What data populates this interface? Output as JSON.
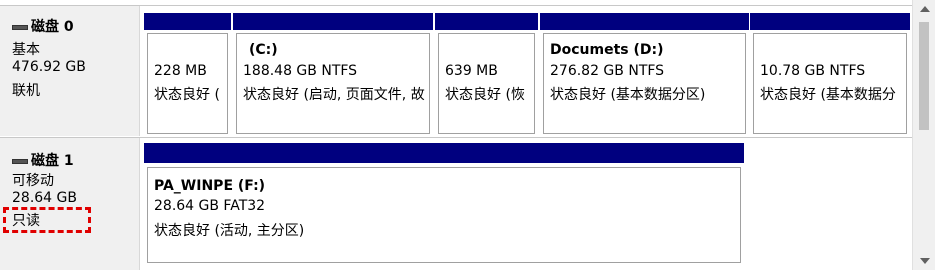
{
  "disks": [
    {
      "name": "磁盘 0",
      "type": "基本",
      "size": "476.92 GB",
      "status": "联机",
      "partitions": [
        {
          "label": "",
          "size_fs": "228 MB",
          "status": "状态良好 ("
        },
        {
          "label": "(C:)",
          "size_fs": "188.48 GB NTFS",
          "status": "状态良好 (启动, 页面文件, 故"
        },
        {
          "label": "",
          "size_fs": "639 MB",
          "status": "状态良好 (恢"
        },
        {
          "label": "Documets  (D:)",
          "size_fs": "276.82 GB NTFS",
          "status": "状态良好 (基本数据分区)"
        },
        {
          "label": "",
          "size_fs": "10.78 GB NTFS",
          "status": "状态良好 (基本数据分"
        }
      ]
    },
    {
      "name": "磁盘 1",
      "type": "可移动",
      "size": "28.64 GB",
      "status": "只读",
      "partitions": [
        {
          "label": "PA_WINPE  (F:)",
          "size_fs": "28.64 GB FAT32",
          "status": "状态良好 (活动, 主分区)"
        }
      ]
    }
  ],
  "colors": {
    "partition_header": "#00007f",
    "highlight": "#e00000",
    "info_bg": "#f0f0f0"
  }
}
